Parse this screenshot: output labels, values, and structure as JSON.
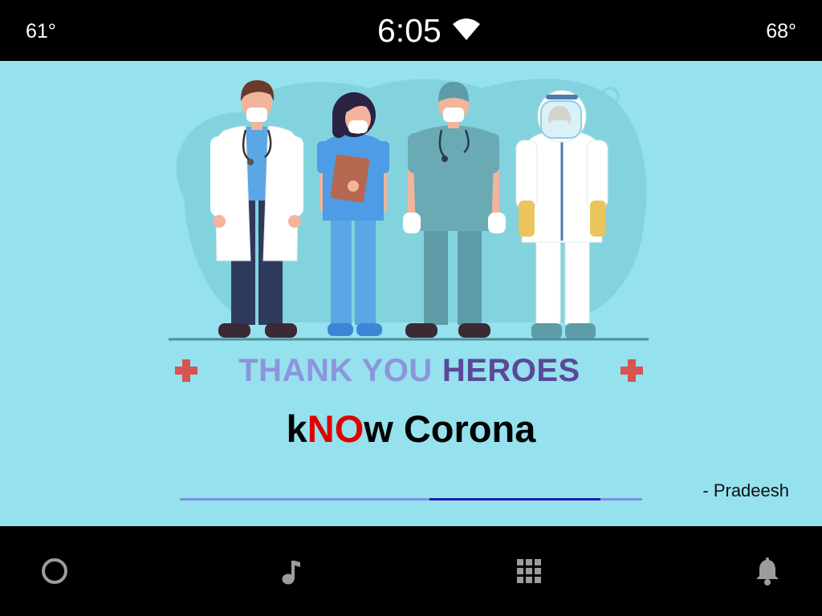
{
  "status_bar": {
    "left_temperature": "61°",
    "time": "6:05",
    "right_temperature": "68°",
    "wifi_icon": "wifi-icon"
  },
  "poster": {
    "caption_light": "THANK YOU",
    "caption_bold": "HEROES",
    "title": {
      "part1": "k",
      "part2_highlight": "NO",
      "part3": "w Corona"
    },
    "author": "- Pradeesh",
    "illustration_icons": [
      "doctor-figure",
      "nurse-figure",
      "surgeon-figure",
      "hazmat-figure",
      "red-cross-icon"
    ]
  },
  "progress": {
    "start": 0.54,
    "end": 0.91
  },
  "bottom_nav": [
    {
      "icon": "home-circle-icon"
    },
    {
      "icon": "music-note-icon"
    },
    {
      "icon": "app-grid-icon"
    },
    {
      "icon": "notification-bell-icon"
    }
  ],
  "colors": {
    "background": "#95E1EE",
    "accent_red": "#E00000",
    "progress_track": "#7E8FE3",
    "progress_fill": "#2818B5",
    "icon_gray": "#9C9C9C"
  }
}
